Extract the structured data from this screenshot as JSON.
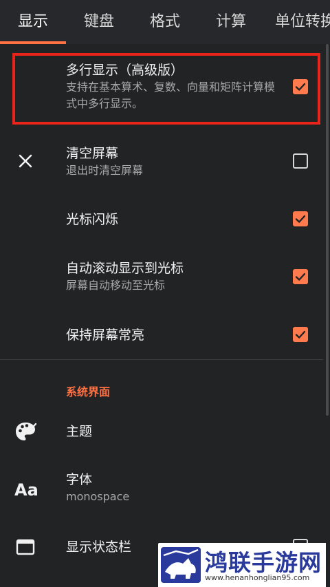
{
  "tabs": [
    {
      "label": "显示"
    },
    {
      "label": "键盘"
    },
    {
      "label": "格式"
    },
    {
      "label": "计算"
    },
    {
      "label": "单位转换"
    }
  ],
  "settings": [
    {
      "title": "多行显示（高级版）",
      "subtitle": "支持在基本算术、复数、向量和矩阵计算模式中多行显示。",
      "checked": true
    },
    {
      "title": "清空屏幕",
      "subtitle": "退出时清空屏幕",
      "checked": false,
      "icon": "close-icon"
    },
    {
      "title": "光标闪烁",
      "checked": true
    },
    {
      "title": "自动滚动显示到光标",
      "subtitle": "屏幕自动移动至光标",
      "checked": true
    },
    {
      "title": "保持屏幕常亮",
      "checked": true
    }
  ],
  "section": {
    "header": "系统界面"
  },
  "system_items": [
    {
      "title": "主题",
      "icon": "palette-icon"
    },
    {
      "title": "字体",
      "subtitle": "monospace",
      "icon": "font-icon"
    },
    {
      "title": "显示状态栏",
      "icon": "window-icon"
    }
  ],
  "colors": {
    "accent": "#ff7043",
    "highlight": "#e8241b",
    "background": "#222325"
  },
  "watermark": {
    "name": "鸿联手游网",
    "url": "www.henanhonglian95.com"
  }
}
